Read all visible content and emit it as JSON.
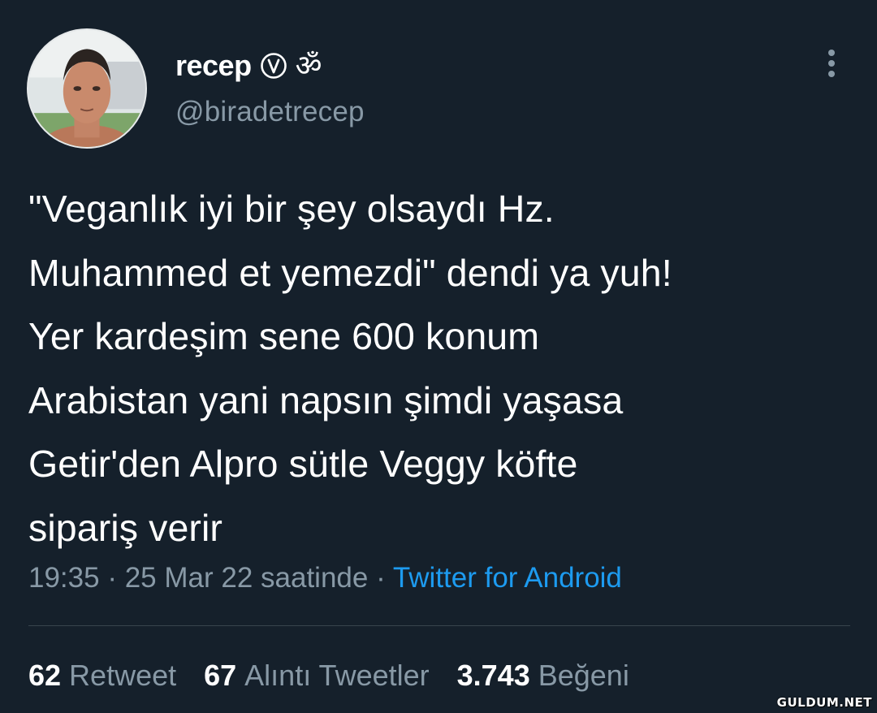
{
  "author": {
    "display_name": "recep",
    "verified_symbol": "ⓥ",
    "extra_symbol": "ॐ",
    "handle": "@biradetrecep"
  },
  "tweet": {
    "text": "\"Veganlık iyi bir şey olsaydı Hz.\nMuhammed et yemezdi\" dendi ya yuh!\nYer kardeşim sene 600 konum\nArabistan yani napsın şimdi yaşasa\nGetir'den Alpro sütle Veggy köfte\nsipariş verir",
    "time": "19:35",
    "date": "25 Mar 22 saatinde",
    "separator": " · ",
    "source": "Twitter for Android"
  },
  "stats": {
    "retweets_count": "62",
    "retweets_label": "Retweet",
    "quotes_count": "67",
    "quotes_label": "Alıntı Tweetler",
    "likes_count": "3.743",
    "likes_label": "Beğeni"
  },
  "watermark": "GULDUM.NET",
  "colors": {
    "background": "#15202b",
    "text": "#ffffff",
    "secondary": "#8899a6",
    "link": "#1d9bf0",
    "divider": "#38444d"
  },
  "icons": {
    "more": "more-vertical-icon",
    "verified": "circled-v-icon"
  }
}
